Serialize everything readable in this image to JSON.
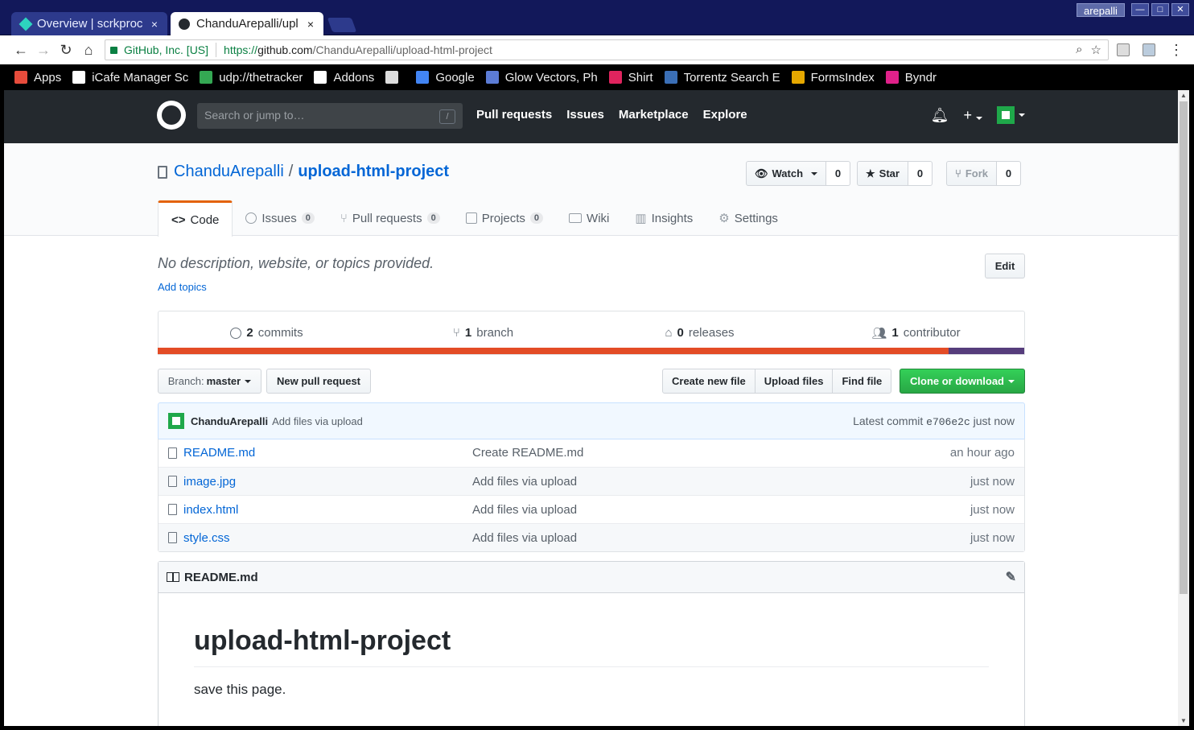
{
  "browser": {
    "tabs": [
      {
        "title": "Overview | scrkproc",
        "close": "×",
        "active": false
      },
      {
        "title": "ChanduArepalli/upl",
        "close": "×",
        "active": true
      }
    ],
    "user": "arepalli",
    "window_buttons": [
      "—",
      "□",
      "✕"
    ],
    "omnibox": {
      "security_label": "GitHub, Inc. [US]",
      "url_scheme": "https://",
      "url_host": "github.com",
      "url_path": "/ChanduArepalli/upload-html-project"
    },
    "bookmarks": [
      {
        "label": "Apps",
        "icon": "apps-grid-icon",
        "color": "#e74c3c"
      },
      {
        "label": "iCafe Manager Sc",
        "icon": "page-icon",
        "color": "#ffffff"
      },
      {
        "label": "udp://thetracker",
        "icon": "star-badge-icon",
        "color": "#34a853"
      },
      {
        "label": "Addons",
        "icon": "page-icon",
        "color": "#ffffff"
      },
      {
        "label": "",
        "icon": "folder-icon",
        "color": "#dddddd"
      },
      {
        "label": "Google",
        "icon": "google-icon",
        "color": "#4285f4"
      },
      {
        "label": "Glow Vectors, Ph",
        "icon": "image-icon",
        "color": "#5c7cd6"
      },
      {
        "label": "Shirt",
        "icon": "shirt-icon",
        "color": "#e0245e"
      },
      {
        "label": "Torrentz Search E",
        "icon": "torrentz-icon",
        "color": "#3b6fb6"
      },
      {
        "label": "FormsIndex",
        "icon": "forms-icon",
        "color": "#e6a800"
      },
      {
        "label": "Byndr",
        "icon": "byndr-icon",
        "color": "#e0218a"
      }
    ]
  },
  "github": {
    "search_placeholder": "Search or jump to…",
    "search_shortcut": "/",
    "nav": [
      "Pull requests",
      "Issues",
      "Marketplace",
      "Explore"
    ],
    "plus": "+"
  },
  "repo": {
    "owner": "ChanduArepalli",
    "separator": "/",
    "name": "upload-html-project",
    "watch": {
      "label": "Watch",
      "count": "0"
    },
    "star": {
      "label": "Star",
      "count": "0"
    },
    "fork": {
      "label": "Fork",
      "count": "0"
    },
    "tabs": [
      {
        "label": "Code",
        "counter": ""
      },
      {
        "label": "Issues",
        "counter": "0"
      },
      {
        "label": "Pull requests",
        "counter": "0"
      },
      {
        "label": "Projects",
        "counter": "0"
      },
      {
        "label": "Wiki",
        "counter": ""
      },
      {
        "label": "Insights",
        "counter": ""
      },
      {
        "label": "Settings",
        "counter": ""
      }
    ],
    "description": "No description, website, or topics provided.",
    "add_topics": "Add topics",
    "edit": "Edit",
    "summary": [
      {
        "num": "2",
        "label": "commits"
      },
      {
        "num": "1",
        "label": "branch"
      },
      {
        "num": "0",
        "label": "releases"
      },
      {
        "num": "1",
        "label": "contributor"
      }
    ],
    "languages": [
      {
        "color": "#e34c26",
        "share": 0.913
      },
      {
        "color": "#563d7c",
        "share": 0.087
      }
    ],
    "branch_label": "Branch:",
    "branch": "master",
    "new_pr": "New pull request",
    "file_buttons": [
      "Create new file",
      "Upload files",
      "Find file"
    ],
    "clone": "Clone or download",
    "latest_commit": {
      "author": "ChanduArepalli",
      "message": "Add files via upload",
      "prefix": "Latest commit",
      "sha": "e706e2c",
      "age": "just now"
    },
    "files": [
      {
        "name": "README.md",
        "message": "Create README.md",
        "age": "an hour ago"
      },
      {
        "name": "image.jpg",
        "message": "Add files via upload",
        "age": "just now"
      },
      {
        "name": "index.html",
        "message": "Add files via upload",
        "age": "just now"
      },
      {
        "name": "style.css",
        "message": "Add files via upload",
        "age": "just now"
      }
    ],
    "readme": {
      "filename": "README.md",
      "heading": "upload-html-project",
      "body": "save this page."
    }
  }
}
